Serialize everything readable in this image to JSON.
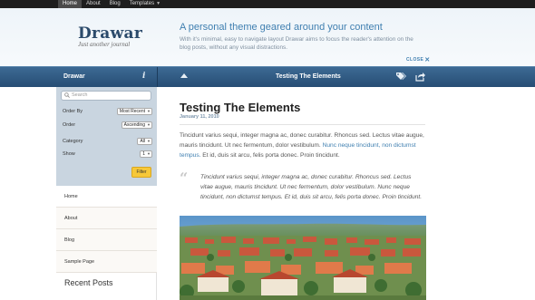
{
  "topnav": {
    "items": [
      {
        "label": "Home",
        "active": true
      },
      {
        "label": "About",
        "active": false
      },
      {
        "label": "Blog",
        "active": false
      },
      {
        "label": "Templates",
        "active": false,
        "has_dropdown": true
      }
    ]
  },
  "header": {
    "site_title": "Drawar",
    "tagline": "Just another journal",
    "intro_heading": "A personal theme geared around your content",
    "intro_text": "With it's minimal, easy to navigate layout Drawar aims to focus the reader's attention on the blog posts, without any visual distractions.",
    "close_label": "CLOSE"
  },
  "bar": {
    "title": "Drawar",
    "info_icon": "info-icon",
    "post_title": "Testing The Elements"
  },
  "sidebar": {
    "search_placeholder": "Search",
    "filters": [
      {
        "label": "Order By",
        "value": "Most Recent"
      },
      {
        "label": "Order",
        "value": "Ascending"
      },
      {
        "label": "Category",
        "value": "All"
      },
      {
        "label": "Show",
        "value": "1"
      }
    ],
    "filter_button": "Filter",
    "menu": [
      "Home",
      "About",
      "Blog",
      "Sample Page"
    ],
    "recent_heading": "Recent Posts"
  },
  "post": {
    "title": "Testing The Elements",
    "date": "January 11, 2010",
    "para_start": "Tincidunt varius sequi, integer magna ac, donec curabitur. Rhoncus sed. Lectus vitae augue, mauris tincidunt. Ut nec fermentum, dolor vestibulum. ",
    "para_link": "Nunc neque tincidunt, non dictumst tempus.",
    "para_end": " Et id, duis sit arcu, felis porta donec. Proin tincidunt.",
    "quote": "Tincidunt varius sequi, integer magna ac, donec curabitur. Rhoncus sed. Lectus vitae augue, mauris tincidunt. Ut nec fermentum, dolor vestibulum. Nunc neque tincidunt, non dictumst tempus. Et id, duis sit arcu, felis porta donec. Proin tincidunt."
  },
  "colors": {
    "accent": "#3f7fb0",
    "bar": "#2f5880",
    "filter_bg": "#c9d5e0",
    "filter_button": "#f7c839"
  }
}
